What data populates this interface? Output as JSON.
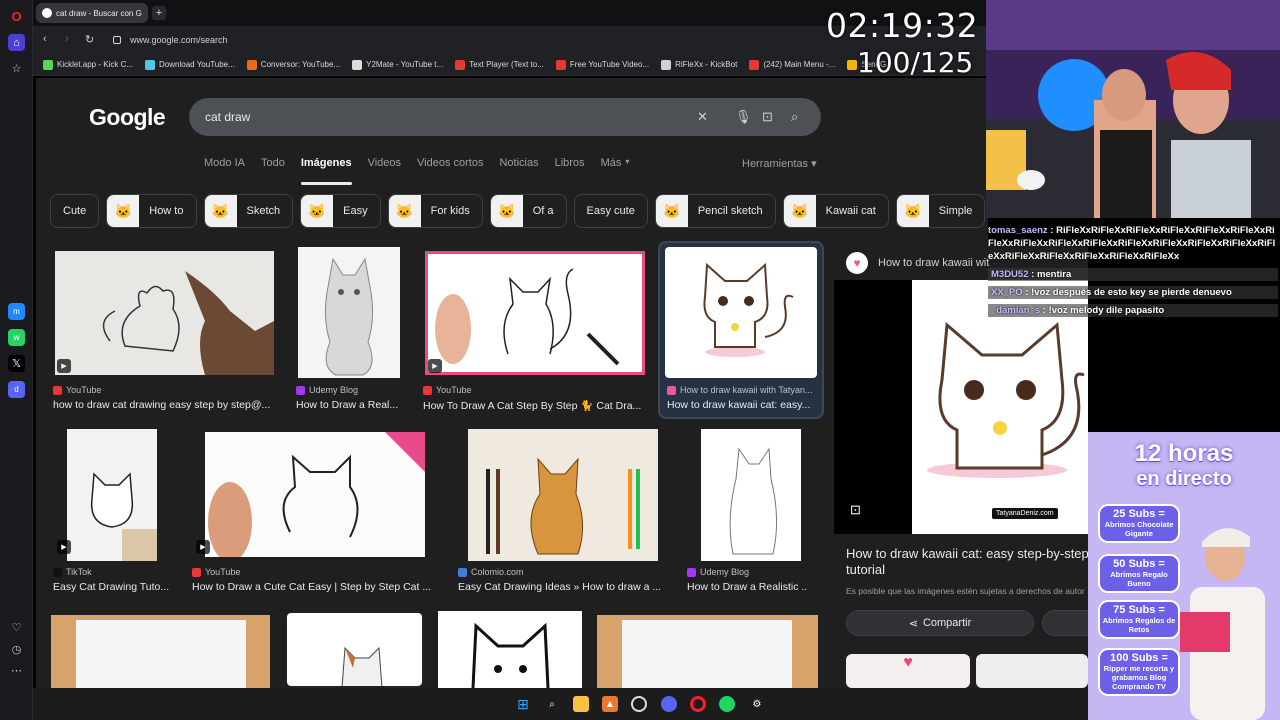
{
  "browser": {
    "tab_title": "cat draw - Buscar con Go",
    "url": "www.google.com/search",
    "bookmarks": [
      {
        "label": "Kicklet.app - Kick C...",
        "color": "#57d657"
      },
      {
        "label": "Download YouTube...",
        "color": "#56c6e8"
      },
      {
        "label": "Conversor: YouTube...",
        "color": "#e56b1f"
      },
      {
        "label": "Y2Mate - YouTube t...",
        "color": "#dddddd"
      },
      {
        "label": "Text Player (Text to...",
        "color": "#e53935"
      },
      {
        "label": "Free YouTube Video...",
        "color": "#e53935"
      },
      {
        "label": "RiFleXx - KickBot",
        "color": "#cfd1d4"
      },
      {
        "label": "(242) Main Menu -...",
        "color": "#e53935"
      },
      {
        "label": "SendG",
        "color": "#f2b705"
      }
    ]
  },
  "google": {
    "logo": "Google",
    "query": "cat draw",
    "tabs": [
      "Modo IA",
      "Todo",
      "Imágenes",
      "Videos",
      "Videos cortos",
      "Noticias",
      "Libros",
      "Más"
    ],
    "active_tab": "Imágenes",
    "tools": "Herramientas",
    "chips": [
      "Cute",
      "How to",
      "Sketch",
      "Easy",
      "For kids",
      "Of a",
      "Easy cute",
      "Pencil sketch",
      "Kawaii cat",
      "Simple"
    ],
    "results_row1": [
      {
        "source": "YouTube",
        "title": "how to draw cat drawing easy step by step@...",
        "src_color": "#e53935"
      },
      {
        "source": "Udemy Blog",
        "title": "How to Draw a Real...",
        "src_color": "#a435f0"
      },
      {
        "source": "YouTube",
        "title": "How To Draw A Cat Step By Step 🐈 Cat Dra...",
        "src_color": "#e53935"
      },
      {
        "source": "How to draw kawaii with Tatyan...",
        "title": "How to draw kawaii cat: easy...",
        "src_color": "#e95a9c"
      }
    ],
    "results_row2": [
      {
        "source": "TikTok",
        "title": "Easy Cat Drawing Tuto...",
        "src_color": "#111111"
      },
      {
        "source": "YouTube",
        "title": "How to Draw a Cute Cat Easy | Step by Step Cat ...",
        "src_color": "#e53935"
      },
      {
        "source": "Colomio.com",
        "title": "Easy Cat Drawing Ideas » How to draw a ...",
        "src_color": "#3b7dd8"
      },
      {
        "source": "Udemy Blog",
        "title": "How to Draw a Realistic ...",
        "src_color": "#a435f0"
      }
    ],
    "preview": {
      "source": "How to draw kawaii wit",
      "watermark": "TatyanaDeniz.com",
      "title": "How to draw kawaii cat: easy step-by-step tutorial",
      "note": "Es posible que las imágenes estén sujetas a derechos de autor",
      "share": "Compartir"
    }
  },
  "stream": {
    "timer": "02:19:32",
    "goal": "100/125",
    "chat": [
      {
        "user": "tomas_saenz",
        "text": "RiFleXxRiFleXxRiFleXxRiFleXxRiFleXxRiFleXxRiFleXxRiFleXxRiFleXxRiFleXxRiFleXxRiFleXxRiFleXxRiFleXxRiFleXxRiFleXxRiFleXxRiFleXxRiFleXxRiFleXx"
      },
      {
        "user": "M3DU52",
        "text": "mentira"
      },
      {
        "user": "XX_PO",
        "text": "!voz después de esto key se pierde denuevo"
      },
      {
        "user": "_damian_s",
        "text": "!voz melody dile papasito"
      }
    ],
    "promo": {
      "title_line1": "12 horas",
      "title_line2": "en directo",
      "goals": [
        {
          "count": "25 Subs =",
          "reward": "Abrimos Chocolate Gigante"
        },
        {
          "count": "50 Subs =",
          "reward": "Abrimos Regalo Bueno"
        },
        {
          "count": "75 Subs =",
          "reward": "Abrimos Regalos de Retos"
        },
        {
          "count": "100 Subs =",
          "reward": "Ripper me recorta y grabamos Blog Comprando TV"
        }
      ]
    }
  }
}
